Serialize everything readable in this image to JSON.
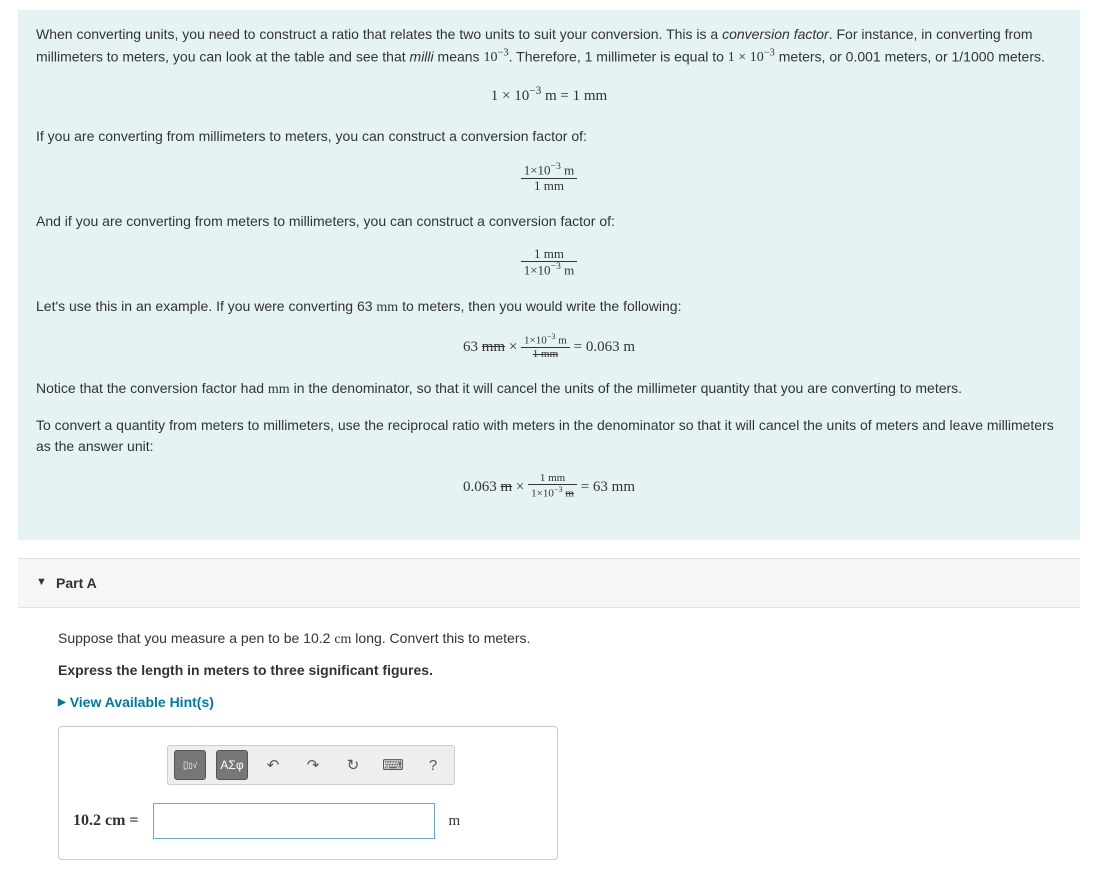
{
  "info": {
    "p1_a": "When converting units, you need to construct a ratio that relates the two units to suit your conversion. This is a ",
    "p1_em1": "conversion factor",
    "p1_b": ". For instance, in converting from millimeters to meters, you can look at the table and see that ",
    "p1_em2": "milli",
    "p1_c": " means ",
    "p1_exp1": "10",
    "p1_exp1_sup": "−3",
    "p1_d": ". Therefore, 1 millimeter is equal to ",
    "p1_val": "1 × 10",
    "p1_val_sup": "−3",
    "p1_e": " meters, or 0.001 meters, or 1/1000 meters.",
    "eq1_left": "1 × 10",
    "eq1_sup": "−3",
    "eq1_right": " m = 1 mm",
    "p2": "If you are converting from millimeters to meters, you can construct a conversion factor of:",
    "frac1_num_a": "1×10",
    "frac1_num_sup": "−3",
    "frac1_num_b": " m",
    "frac1_den": "1 mm",
    "p3": "And if you are converting from meters to millimeters, you can construct a conversion factor of:",
    "frac2_num": "1 mm",
    "frac2_den_a": "1×10",
    "frac2_den_sup": "−3",
    "frac2_den_b": " m",
    "p4_a": "Let's use this in an example. If you were converting 63 ",
    "p4_unit": "mm",
    "p4_b": " to meters, then you would write the following:",
    "eq3_lhs_val": "63 ",
    "eq3_lhs_unit": "mm",
    "eq3_times": " × ",
    "eq3_num_a": "1×10",
    "eq3_num_sup": "−3",
    "eq3_num_b": " m",
    "eq3_den": "1 mm",
    "eq3_rhs": " = 0.063 m",
    "p5_a": "Notice that the conversion factor had ",
    "p5_unit": "mm",
    "p5_b": " in the denominator, so that it will cancel the units of the millimeter quantity that you are converting to meters.",
    "p6": "To convert a quantity from meters to millimeters, use the reciprocal ratio with meters in the denominator so that it will cancel the units of meters and leave millimeters as the answer unit:",
    "eq4_lhs_val": "0.063 ",
    "eq4_lhs_unit": "m",
    "eq4_times": " × ",
    "eq4_num": "1 mm",
    "eq4_den_a": "1×10",
    "eq4_den_sup": "−3",
    "eq4_den_b": " m",
    "eq4_rhs": " = 63 mm"
  },
  "part": {
    "title": "Part A",
    "prompt_a": "Suppose that you measure a pen to be 10.2 ",
    "prompt_unit": "cm",
    "prompt_b": " long. Convert this to meters.",
    "instruction": "Express the length in meters to three significant figures.",
    "hint_label": "View Available Hint(s)",
    "answer_label": "10.2 cm =",
    "answer_unit": "m",
    "toolbar": {
      "template_icon": "▭",
      "root_icon": "√",
      "greek_icon": "ΑΣφ",
      "undo_icon": "↶",
      "redo_icon": "↷",
      "reset_icon": "↻",
      "keyboard_icon": "⌨",
      "help_icon": "?"
    }
  }
}
